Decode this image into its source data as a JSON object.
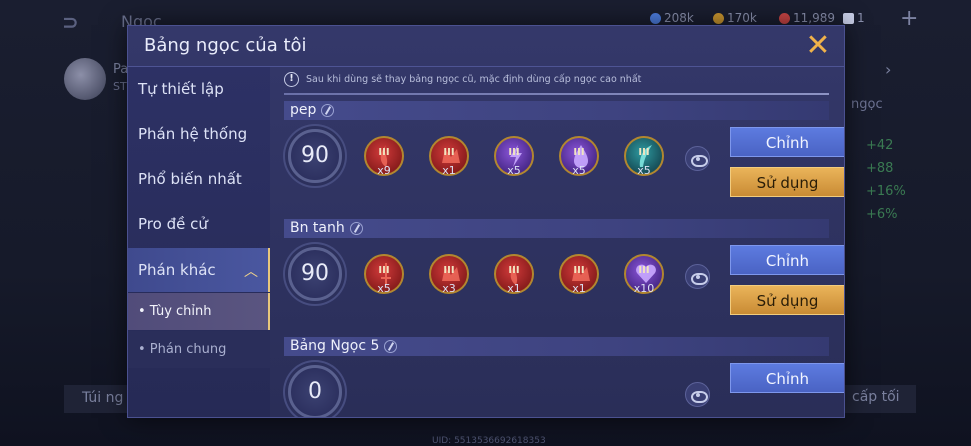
{
  "background": {
    "title": "Ngọc",
    "resources": [
      {
        "value": "208k",
        "color": "#4d7de0"
      },
      {
        "value": "170k",
        "color": "#c9952f"
      },
      {
        "value": "11,989",
        "color": "#c94545"
      },
      {
        "value": "1",
        "color": "#c9cfe8"
      }
    ],
    "hero_name": "Pa",
    "hero_sub": "ST",
    "right_label": "ngọc",
    "stats": [
      "+42",
      "+88",
      "+16%",
      "+6%"
    ],
    "bottom_left": "Túi ng",
    "bottom_right": "cấp tối",
    "uid": "UID: 5513536692618353"
  },
  "modal": {
    "title": "Bảng ngọc của tôi",
    "close_icon": "close-icon",
    "notice": "Sau khi dùng sẽ thay bảng ngọc cũ, mặc định dùng cấp ngọc cao nhất"
  },
  "sidebar": {
    "items": [
      {
        "label": "Tự thiết lập"
      },
      {
        "label": "Phán hệ thống"
      },
      {
        "label": "Phổ biến nhất"
      },
      {
        "label": "Pro đề cử"
      },
      {
        "label": "Phán khác"
      }
    ],
    "subitems": [
      {
        "label": "• Tùy chỉnh"
      },
      {
        "label": "• Phán chung"
      }
    ]
  },
  "pages": [
    {
      "name": "pep",
      "level": "90",
      "gems": [
        {
          "type": "red",
          "tier": "III",
          "count": "x9",
          "icon": "flame-rune-icon"
        },
        {
          "type": "red",
          "tier": "III",
          "count": "x1",
          "icon": "crown-rune-icon"
        },
        {
          "type": "purple",
          "tier": "III",
          "count": "x5",
          "icon": "lightning-rune-icon"
        },
        {
          "type": "purple",
          "tier": "III",
          "count": "x5",
          "icon": "drop-rune-icon"
        },
        {
          "type": "teal",
          "tier": "III",
          "count": "x5",
          "icon": "feather-rune-icon"
        }
      ],
      "edit_label": "Chỉnh",
      "use_label": "Sử dụng"
    },
    {
      "name": "Bn tanh",
      "level": "90",
      "gems": [
        {
          "type": "red",
          "tier": "III",
          "count": "x5",
          "icon": "sword-rune-icon"
        },
        {
          "type": "red",
          "tier": "III",
          "count": "x3",
          "icon": "crown-rune-icon"
        },
        {
          "type": "red",
          "tier": "III",
          "count": "x1",
          "icon": "flame-rune-icon"
        },
        {
          "type": "red",
          "tier": "III",
          "count": "x1",
          "icon": "crown-rune-icon"
        },
        {
          "type": "purple",
          "tier": "III",
          "count": "x10",
          "icon": "heart-rune-icon"
        }
      ],
      "edit_label": "Chỉnh",
      "use_label": "Sử dụng"
    },
    {
      "name": "Bảng Ngọc 5",
      "level": "0",
      "gems": [],
      "edit_label": "Chỉnh",
      "use_label": ""
    }
  ]
}
